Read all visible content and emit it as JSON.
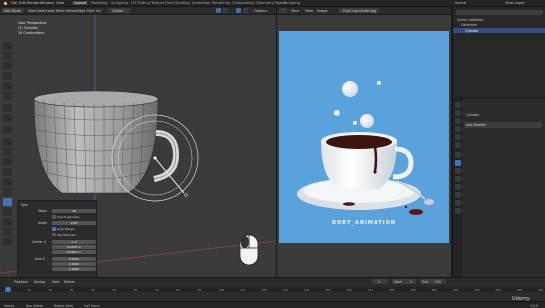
{
  "topbar": {
    "menus": [
      "File",
      "Edit",
      "Render",
      "Window",
      "Help"
    ],
    "workspaces": [
      "Layout",
      "Modeling",
      "Sculpting",
      "UV Editing",
      "Texture Paint",
      "Shading",
      "Animation",
      "Rendering",
      "Compositing",
      "Geometry Nodes",
      "Scripting"
    ],
    "active_workspace": "Layout",
    "scene": "Scene",
    "view_layer": "View Layer"
  },
  "viewport_header": {
    "mode": "Edit Mode",
    "menus": [
      "View",
      "Select",
      "Add",
      "Mesh",
      "Vertex",
      "Edge",
      "Face",
      "UV"
    ],
    "orientation": "Global",
    "pivot_label": "Options"
  },
  "viewport": {
    "view_name": "User Perspective",
    "object_label": "(1) Cylinder",
    "units_label": "10 Centimeters"
  },
  "operator_panel": {
    "title": "Spin",
    "steps_label": "Steps",
    "steps_value": "16",
    "dupli_label": "Use Duplicates",
    "angle_label": "Angle",
    "angle_value": "-180°",
    "auto_merge_label": "Auto Merge",
    "flip_normals_label": "Flip Normals",
    "center_label": "Center X",
    "center_values": [
      "2 m",
      "0.0595 m",
      "0.4905 m"
    ],
    "axis_label": "Axis X",
    "axis_values": [
      "0.0000",
      "0.0000",
      "1.0000"
    ]
  },
  "image_editor": {
    "menus": [
      "View",
      "View",
      "Image"
    ],
    "image_name": "Final cup.render.jpg",
    "caption": "DORY_ANIMATION"
  },
  "outliner": {
    "search_placeholder": "",
    "rows": [
      "Scene Collection",
      "Collection",
      "Cylinder"
    ]
  },
  "properties": {
    "object_name": "Cylinder",
    "add_modifier": "Add Modifier"
  },
  "timeline": {
    "menus": [
      "Playback",
      "Keying",
      "View",
      "Marker"
    ],
    "current_frame": "1",
    "start_label": "Start",
    "start_value": "1",
    "end_label": "End",
    "end_value": "250",
    "ticks": [
      "0",
      "10",
      "20",
      "30",
      "40",
      "50",
      "60",
      "70",
      "80",
      "90",
      "100",
      "110",
      "120",
      "130",
      "140",
      "150",
      "160",
      "170",
      "180",
      "190",
      "200",
      "210",
      "220",
      "230",
      "240",
      "250"
    ]
  },
  "statusbar": {
    "items": [
      "Select",
      "Box Select",
      "Rotate View",
      "Call Menu"
    ],
    "version": "3.0.0"
  },
  "watermark": "Udemy",
  "colors": {
    "accent": "#4772b3",
    "render_bg": "#5aa2dc",
    "coffee": "#3d1510"
  }
}
